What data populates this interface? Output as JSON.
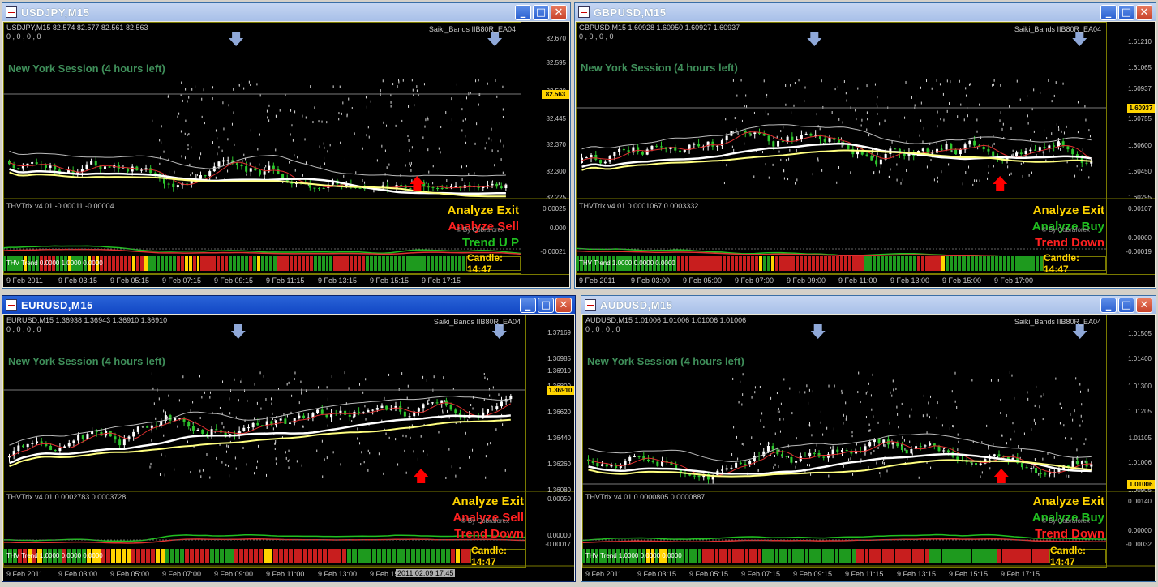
{
  "windows": [
    {
      "id": "usdjpy",
      "title": "USDJPY,M15",
      "active": false,
      "info": "USDJPY,M15  82.574 82.577 82.561 82.563",
      "zeros": "0 , 0 , 0 , 0",
      "ea": "Saiki_Bands IIB80R_EA04",
      "session": "New York Session (4 hours left)",
      "price_ticks": [
        "82.670",
        "82.595",
        "82.520",
        "82.445",
        "82.370",
        "82.300",
        "82.225"
      ],
      "current_price": "82.563",
      "trix_label": "THVTrix v4.01 -0.00011 -0.00004",
      "trix_ticks": [
        "0.00025",
        "0.000",
        "-0.00021"
      ],
      "signals": [
        {
          "text": "Analyze Exit",
          "color": "#ffd400"
        },
        {
          "text": "Analyze Sell",
          "color": "#ff2020"
        },
        {
          "text": "Trend U P",
          "color": "#20c020"
        }
      ],
      "cobra": "© By Cobraforex",
      "trend_label": "THV Trend 0.0000 1.0000 0.0000",
      "candle": "Candle:  14:47",
      "times": [
        "9 Feb 2011",
        "9 Feb 03:15",
        "9 Feb 05:15",
        "9 Feb 07:15",
        "9 Feb 09:15",
        "9 Feb 11:15",
        "9 Feb 13:15",
        "9 Feb 15:15",
        "9 Feb 17:15"
      ],
      "trend_colors": "GGGGGYGGGRRRRGGGYGGGGYRYRRRRRRRRYRRYGGGGGGGRRYYRYRRRRRRRGGGGGRGYGGGGRRRRRRRRRGGGGGRRRRRRRRGGGGGGGGGGGGGGGGGGGGGGGGG"
    },
    {
      "id": "gbpusd",
      "title": "GBPUSD,M15",
      "active": false,
      "info": "GBPUSD,M15  1.60928 1.60950 1.60927 1.60937",
      "zeros": "0 , 0 , 0 , 0",
      "ea": "Saiki_Bands IIB80R_EA04",
      "session": "New York Session (4 hours left)",
      "price_ticks": [
        "1.61210",
        "1.61065",
        "1.60937",
        "1.60755",
        "1.60600",
        "1.60450",
        "1.60295"
      ],
      "current_price": "1.60937",
      "trix_label": "THVTrix v4.01 0.0001067 0.0003332",
      "trix_ticks": [
        "0.00107",
        "0.00000",
        "-0.00019"
      ],
      "signals": [
        {
          "text": "Analyze Exit",
          "color": "#ffd400"
        },
        {
          "text": "Analyze Buy",
          "color": "#20c020"
        },
        {
          "text": "Trend Down",
          "color": "#ff2020"
        }
      ],
      "cobra": "© By Cobraforex",
      "trend_label": "THV Trend 1.0000 0.0000 0.0000",
      "candle": "Candle:  14:47",
      "times": [
        "9 Feb 2011",
        "9 Feb 03:00",
        "9 Feb 05:00",
        "9 Feb 07:00",
        "9 Feb 09:00",
        "9 Feb 11:00",
        "9 Feb 13:00",
        "9 Feb 15:00",
        "9 Feb 17:00"
      ],
      "trend_colors": "GGGGGGGGGGGGGGGGGGGGGGGGGRRRRRRRRRRRRRRRRRRRRYGGYRRRRRRRRRRRRRRRRRRRRRRGGGGGGGGGGGGGRRRRRRYGGGGGGGGGGGGGGGGGGGGGGGG"
    },
    {
      "id": "eurusd",
      "title": "EURUSD,M15",
      "active": true,
      "info": "EURUSD,M15  1.36938 1.36943 1.36910 1.36910",
      "zeros": "0 , 0 , 0 , 0",
      "ea": "Saiki_Bands IIB80R_EA04",
      "session": "New York Session (4 hours left)",
      "price_ticks": [
        "1.37169",
        "1.36985",
        "1.36910",
        "1.36800",
        "1.36620",
        "1.36440",
        "1.36260",
        "1.36080"
      ],
      "current_price": "1.36910",
      "trix_label": "THVTrix v4.01 0.0002783 0.0003728",
      "trix_ticks": [
        "0.00050",
        "0.00000",
        "-0.00017"
      ],
      "signals": [
        {
          "text": "Analyze Exit",
          "color": "#ffd400"
        },
        {
          "text": "Analyze Sell",
          "color": "#ff2020"
        },
        {
          "text": "Trend Down",
          "color": "#ff2020"
        }
      ],
      "cobra": "© By Cobraforex",
      "trend_label": "THV Trend 1.0000 0.0000 0.0000",
      "candle": "Candle:  14:47",
      "times": [
        "9 Feb 2011",
        "9 Feb 03:00",
        "9 Feb 05:00",
        "9 Feb 07:00",
        "9 Feb 09:00",
        "9 Feb 11:00",
        "9 Feb 13:00",
        "9 Feb 15:00"
      ],
      "crosshair_time": "2011.02.09 17:45",
      "trend_colors": "GGGRRYRYGGGGRGGGGYYYRRYYYYRRRRRYYGGGGRRRRRGGGGGRRRRRRYYRRRRRRRRRRRRRRRGGGGGGGGGGGGGGGGGGGGGRYRR"
    },
    {
      "id": "audusd",
      "title": "AUDUSD,M15",
      "active": false,
      "info": "AUDUSD,M15  1.01006 1.01006 1.01006 1.01006",
      "zeros": "0 , 0 , 0 , 0",
      "ea": "Saiki_Bands IIB80R_EA04",
      "session": "New York Session (4 hours left)",
      "price_ticks": [
        "1.01505",
        "1.01400",
        "1.01300",
        "1.01205",
        "1.01105",
        "1.01006",
        "1.00905"
      ],
      "current_price": "1.01006",
      "trix_label": "THVTrix v4.01 0.0000805 0.0000887",
      "trix_ticks": [
        "0.00140",
        "0.00000",
        "-0.00032"
      ],
      "signals": [
        {
          "text": "Analyze Exit",
          "color": "#ffd400"
        },
        {
          "text": "Analyze Buy",
          "color": "#20c020"
        },
        {
          "text": "Trend Down",
          "color": "#ff2020"
        }
      ],
      "cobra": "© By Cobraforex",
      "trend_label": "THV Trend 1.0000 0.0000 0.0000",
      "candle": "Candle:  14:47",
      "times": [
        "9 Feb 2011",
        "9 Feb 03:15",
        "9 Feb 05:15",
        "9 Feb 07:15",
        "9 Feb 09:15",
        "9 Feb 11:15",
        "9 Feb 13:15",
        "9 Feb 15:15",
        "9 Feb 17:15"
      ],
      "trend_colors": "GGGGGGGGGGGGGGGYYGYYGGGGGGGGRRRRRRRRRRRRRRGGGGGGGGGGGGGGGGGGGGGGRRRRRRRRRRRRRRRRRGGGGGGGGGGGGGGGGRRRRRRRRRRRR"
    }
  ],
  "colors": {
    "up_candle": "#ffffff",
    "down_candle": "#2ec82e",
    "trend_green": "#1e9a1e",
    "trend_red": "#c81e1e",
    "trend_yellow": "#ffd400",
    "price_box": "#ffd400",
    "buy_arrow": "#ff0000",
    "sell_arrow": "#8fa8d8",
    "pink_arrow": "#f0a8c0"
  },
  "icons": [
    "chart-window-icon",
    "minimize-icon",
    "maximize-icon",
    "close-icon"
  ],
  "window_buttons": {
    "minimize": "_",
    "maximize": "□",
    "close": "✕"
  }
}
